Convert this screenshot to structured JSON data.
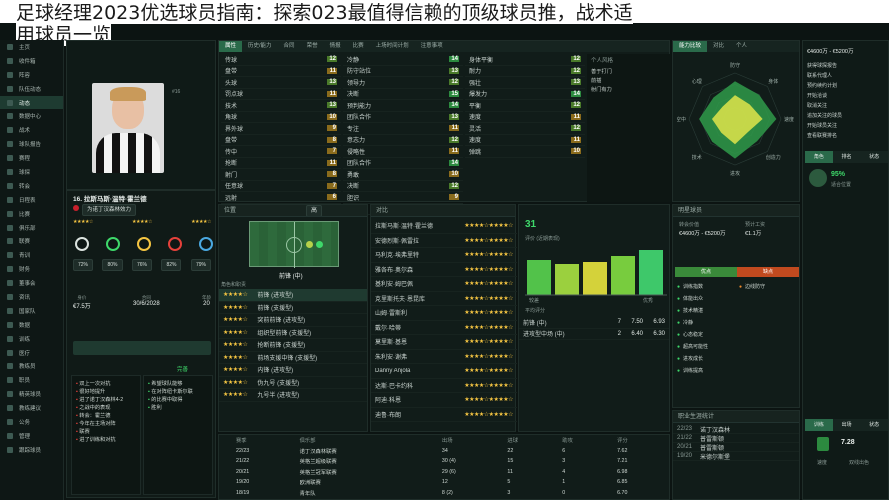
{
  "title": "足球经理2023优选球员指南：探索023最值得信赖的顶级球员推荐一览，战术适用球员一览",
  "title_line1": "足球经理2023优选球员指南：探索023最值得信赖的顶级球员推",
  "title_line2": "用球员一览",
  "title_right": "，战术适",
  "player": {
    "number_name": "16. 拉斯马斯·温特·霍兰德",
    "status": "为诺丁汉森林效力",
    "transfer_value": "€7.5万",
    "contract": "30/6/2028",
    "age": "20"
  },
  "nav": {
    "items": [
      "主页",
      "收件箱",
      "阵容",
      "队伍动态",
      "动态",
      "数据中心",
      "战术",
      "球队报告",
      "赛程",
      "球探",
      "转会",
      "日程表",
      "比赛",
      "俱乐部",
      "联赛",
      "青训",
      "财务",
      "董事会",
      "资讯",
      "国家队",
      "数据",
      "训练",
      "医疗",
      "教练员",
      "职员",
      "精英球员",
      "教练建议",
      "公务",
      "管理",
      "跟踪球员"
    ],
    "active_index": 4
  },
  "attr_tabs": [
    "属性",
    "历史/能力",
    "合同",
    "荣誉",
    "情报",
    "比赛",
    "上场时间计划",
    "注意事项"
  ],
  "tech_attrs": [
    [
      "传球",
      "12"
    ],
    [
      "盘带",
      "11"
    ],
    [
      "头球",
      "13"
    ],
    [
      "罚点球",
      "11"
    ],
    [
      "技术",
      "13"
    ],
    [
      "角球",
      "10"
    ],
    [
      "界外球",
      "9"
    ],
    [
      "盘带",
      "8"
    ],
    [
      "传中",
      "7"
    ],
    [
      "抢断",
      "11"
    ],
    [
      "射门",
      "8"
    ],
    [
      "任意球",
      "7"
    ],
    [
      "远射",
      "6"
    ]
  ],
  "mental_attrs": [
    [
      "冷静",
      "14"
    ],
    [
      "防守站位",
      "13"
    ],
    [
      "领导力",
      "12"
    ],
    [
      "决断",
      "15"
    ],
    [
      "预判能力",
      "14"
    ],
    [
      "团队合作",
      "13"
    ],
    [
      "专注",
      "11"
    ],
    [
      "意志力",
      "12"
    ],
    [
      "侵略性",
      "11"
    ],
    [
      "团队合作",
      "14"
    ],
    [
      "勇敢",
      "10"
    ],
    [
      "决断",
      "12"
    ],
    [
      "胆识",
      "9"
    ],
    [
      "视野",
      "11"
    ]
  ],
  "phys_attrs": [
    [
      "身体平衡",
      "12"
    ],
    [
      "耐力",
      "12"
    ],
    [
      "强壮",
      "13"
    ],
    [
      "爆发力",
      "14"
    ],
    [
      "平衡",
      "12"
    ],
    [
      "速度",
      "11"
    ],
    [
      "灵活",
      "12"
    ],
    [
      "速度",
      "11"
    ],
    [
      "弹跳",
      "10"
    ]
  ],
  "traits_header": "个人风格",
  "traits": [
    "善于打门",
    "前插",
    "射门有力"
  ],
  "radar_labels": [
    "防守",
    "身体",
    "速度",
    "创造力",
    "进攻",
    "技术",
    "空中",
    "心理"
  ],
  "right_tabs": [
    "能力比较",
    "对比",
    "个人"
  ],
  "scout": {
    "title": "明星球员",
    "value_label": "转会价值",
    "value": "€4600万 - €5200万",
    "wage_label": "预计工资",
    "wage": "€1.1万",
    "unknown1": "未知",
    "unknown2": "未知",
    "pros_label": "优点",
    "cons_label": "缺点",
    "pros": [
      "训练指数",
      "体能出众",
      "技术精湛",
      "冷静",
      "心态稳定",
      "超高可能性",
      "进攻成长",
      "训练提高"
    ],
    "cons": [
      "边线防守"
    ]
  },
  "far_right": {
    "header": "€4600万 - €5200万",
    "items": [
      "获得球探报告",
      "联系代理人",
      "预约续约计划",
      "开始洽谈",
      "取消关注",
      "追加关注的球员",
      "开始球员关注",
      "查看联赛排名"
    ],
    "role_tabs": [
      "角色",
      "排名",
      "状态"
    ],
    "role_rating": "95%",
    "role_name": "适合位置",
    "stats_tabs": [
      "训练",
      "出场",
      "状态"
    ],
    "rating": "7.28",
    "speed": "速度",
    "dual": "双线出色"
  },
  "position": {
    "label": "位置",
    "role": "前锋 (中)",
    "rating_label": "高"
  },
  "roles": [
    [
      "前锋",
      "进攻型"
    ],
    [
      "前锋",
      "支援型"
    ],
    [
      "突前前锋",
      "进攻型"
    ],
    [
      "组织型前锋",
      "支援型"
    ],
    [
      "抢断前锋",
      "支援型"
    ],
    [
      "前场支援中锋",
      "支援型"
    ],
    [
      "内锋",
      "进攻型"
    ],
    [
      "伪九号",
      "支援型"
    ],
    [
      "九号半",
      "进攻型"
    ]
  ],
  "compare": {
    "title": "对比",
    "players": [
      "拉斯马斯·温特·霍兰德",
      "安德烈斯·佩雷拉",
      "马利克·埃弗里特",
      "雅各布·奥尔森",
      "基利安·姆巴佩",
      "克里斯托夫·恩昆库",
      "山姆·雷斯利",
      "戴尔·哈蒂",
      "莫里斯·基恩",
      "朱利安·谢弗",
      "Danny Anjola",
      "达斯·巴卡约科",
      "阿迪·科恩",
      "迪鲁·布朗"
    ]
  },
  "perf": {
    "rating": "31",
    "label": "评价 (近期表现)",
    "low": "较差",
    "high": "优秀",
    "avg_label": "平均评分",
    "avg": "7.50",
    "rows": [
      [
        "前锋 (中)",
        "7",
        "7.50",
        "6.93"
      ],
      [
        "进攻型中场 (中)",
        "2",
        "6.40",
        "6.30"
      ]
    ]
  },
  "history": {
    "headers": [
      "赛季",
      "俱乐部",
      "出场",
      "进球",
      "助攻",
      "评分"
    ],
    "rows": [
      [
        "22/23",
        "诺丁汉森林联赛",
        "34",
        "22",
        "6",
        "7.62"
      ],
      [
        "21/22",
        "英格兰超级联赛",
        "30 (4)",
        "15",
        "3",
        "7.21"
      ],
      [
        "20/21",
        "英格兰冠军联赛",
        "29 (6)",
        "11",
        "4",
        "6.98"
      ],
      [
        "19/20",
        "欧洲联赛",
        "12",
        "5",
        "1",
        "6.85"
      ],
      [
        "18/19",
        "青年队",
        "8 (2)",
        "3",
        "0",
        "6.70"
      ]
    ]
  },
  "career": {
    "title": "职业生涯统计",
    "rows": [
      [
        "22/23",
        "诺丁汉森林"
      ],
      [
        "21/22",
        "普雷斯顿"
      ],
      [
        "20/21",
        "普雷斯顿"
      ],
      [
        "19/20",
        "米德尔斯堡"
      ]
    ]
  },
  "scouting_note": {
    "title": "完善",
    "lines": [
      "双上一次对抗",
      "很好地提升",
      "进了诺丁汉森林4-2",
      "之战中的表现",
      "转会：霍兰德",
      "今年在主场对阵",
      "联赛",
      "进了训练和对抗"
    ]
  },
  "scouting_note2": {
    "lines": [
      "希望球队能够",
      "在对阵纽卡斯尔联",
      "的比赛中取得",
      "胜利"
    ]
  },
  "colors": {
    "accent": "#3ed86a",
    "bg": "#0c1412",
    "panel": "#111c19",
    "tabOn": "#2a6a4a"
  },
  "radar": {
    "outer": [
      0.82,
      0.74,
      0.9,
      0.68,
      0.86,
      0.7,
      0.78,
      0.66
    ],
    "inner": [
      0.52,
      0.45,
      0.6,
      0.4,
      0.55,
      0.42,
      0.5,
      0.38
    ]
  }
}
